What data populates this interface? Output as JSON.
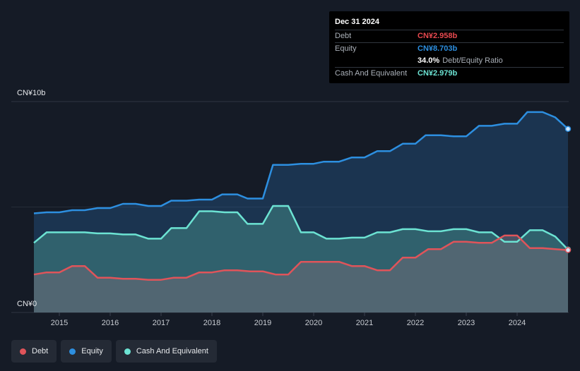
{
  "tooltip": {
    "date": "Dec 31 2024",
    "debt_label": "Debt",
    "debt_value": "CN¥2.958b",
    "equity_label": "Equity",
    "equity_value": "CN¥8.703b",
    "ratio_value": "34.0%",
    "ratio_label": "Debt/Equity Ratio",
    "cash_label": "Cash And Equivalent",
    "cash_value": "CN¥2.979b"
  },
  "legend": [
    {
      "label": "Debt",
      "color": "#e0545a"
    },
    {
      "label": "Equity",
      "color": "#2d8fe0"
    },
    {
      "label": "Cash And Equivalent",
      "color": "#6ce3d3"
    }
  ],
  "chart_data": {
    "type": "area",
    "y_top_label": "CN¥10b",
    "y_bottom_label": "CN¥0",
    "ylim": [
      0,
      10
    ],
    "xlim": [
      2014.5,
      2025.0
    ],
    "x_ticks": [
      "2015",
      "2016",
      "2017",
      "2018",
      "2019",
      "2020",
      "2021",
      "2022",
      "2023",
      "2024"
    ],
    "series": [
      {
        "name": "Equity",
        "color": "#2d8fe0",
        "points": [
          [
            2014.5,
            4.7
          ],
          [
            2014.75,
            4.75
          ],
          [
            2015.0,
            4.75
          ],
          [
            2015.25,
            4.85
          ],
          [
            2015.5,
            4.85
          ],
          [
            2015.75,
            4.95
          ],
          [
            2016.0,
            4.95
          ],
          [
            2016.25,
            5.15
          ],
          [
            2016.5,
            5.15
          ],
          [
            2016.75,
            5.05
          ],
          [
            2017.0,
            5.05
          ],
          [
            2017.2,
            5.3
          ],
          [
            2017.5,
            5.3
          ],
          [
            2017.75,
            5.35
          ],
          [
            2018.0,
            5.35
          ],
          [
            2018.2,
            5.6
          ],
          [
            2018.5,
            5.6
          ],
          [
            2018.7,
            5.4
          ],
          [
            2019.0,
            5.4
          ],
          [
            2019.2,
            7.0
          ],
          [
            2019.5,
            7.0
          ],
          [
            2019.75,
            7.05
          ],
          [
            2020.0,
            7.05
          ],
          [
            2020.2,
            7.15
          ],
          [
            2020.5,
            7.15
          ],
          [
            2020.75,
            7.35
          ],
          [
            2021.0,
            7.35
          ],
          [
            2021.25,
            7.65
          ],
          [
            2021.5,
            7.65
          ],
          [
            2021.75,
            8.0
          ],
          [
            2022.0,
            8.0
          ],
          [
            2022.2,
            8.4
          ],
          [
            2022.5,
            8.4
          ],
          [
            2022.75,
            8.35
          ],
          [
            2023.0,
            8.35
          ],
          [
            2023.25,
            8.85
          ],
          [
            2023.5,
            8.85
          ],
          [
            2023.75,
            8.95
          ],
          [
            2024.0,
            8.95
          ],
          [
            2024.2,
            9.5
          ],
          [
            2024.5,
            9.5
          ],
          [
            2024.75,
            9.25
          ],
          [
            2025.0,
            8.703
          ]
        ]
      },
      {
        "name": "Cash And Equivalent",
        "color": "#6ce3d3",
        "points": [
          [
            2014.5,
            3.3
          ],
          [
            2014.75,
            3.8
          ],
          [
            2015.0,
            3.8
          ],
          [
            2015.25,
            3.8
          ],
          [
            2015.5,
            3.8
          ],
          [
            2015.75,
            3.75
          ],
          [
            2016.0,
            3.75
          ],
          [
            2016.25,
            3.7
          ],
          [
            2016.5,
            3.7
          ],
          [
            2016.75,
            3.5
          ],
          [
            2017.0,
            3.5
          ],
          [
            2017.2,
            4.0
          ],
          [
            2017.5,
            4.0
          ],
          [
            2017.75,
            4.8
          ],
          [
            2018.0,
            4.8
          ],
          [
            2018.25,
            4.75
          ],
          [
            2018.5,
            4.75
          ],
          [
            2018.7,
            4.2
          ],
          [
            2019.0,
            4.2
          ],
          [
            2019.2,
            5.05
          ],
          [
            2019.5,
            5.05
          ],
          [
            2019.75,
            3.8
          ],
          [
            2020.0,
            3.8
          ],
          [
            2020.25,
            3.5
          ],
          [
            2020.5,
            3.5
          ],
          [
            2020.75,
            3.55
          ],
          [
            2021.0,
            3.55
          ],
          [
            2021.25,
            3.8
          ],
          [
            2021.5,
            3.8
          ],
          [
            2021.75,
            3.95
          ],
          [
            2022.0,
            3.95
          ],
          [
            2022.25,
            3.85
          ],
          [
            2022.5,
            3.85
          ],
          [
            2022.75,
            3.95
          ],
          [
            2023.0,
            3.95
          ],
          [
            2023.25,
            3.8
          ],
          [
            2023.5,
            3.8
          ],
          [
            2023.75,
            3.35
          ],
          [
            2024.0,
            3.35
          ],
          [
            2024.25,
            3.9
          ],
          [
            2024.5,
            3.9
          ],
          [
            2024.75,
            3.6
          ],
          [
            2025.0,
            2.979
          ]
        ]
      },
      {
        "name": "Debt",
        "color": "#e0545a",
        "points": [
          [
            2014.5,
            1.8
          ],
          [
            2014.75,
            1.9
          ],
          [
            2015.0,
            1.9
          ],
          [
            2015.25,
            2.2
          ],
          [
            2015.5,
            2.2
          ],
          [
            2015.75,
            1.65
          ],
          [
            2016.0,
            1.65
          ],
          [
            2016.25,
            1.6
          ],
          [
            2016.5,
            1.6
          ],
          [
            2016.75,
            1.55
          ],
          [
            2017.0,
            1.55
          ],
          [
            2017.25,
            1.65
          ],
          [
            2017.5,
            1.65
          ],
          [
            2017.75,
            1.9
          ],
          [
            2018.0,
            1.9
          ],
          [
            2018.25,
            2.0
          ],
          [
            2018.5,
            2.0
          ],
          [
            2018.75,
            1.95
          ],
          [
            2019.0,
            1.95
          ],
          [
            2019.25,
            1.8
          ],
          [
            2019.5,
            1.8
          ],
          [
            2019.75,
            2.4
          ],
          [
            2020.0,
            2.4
          ],
          [
            2020.25,
            2.4
          ],
          [
            2020.5,
            2.4
          ],
          [
            2020.75,
            2.2
          ],
          [
            2021.0,
            2.2
          ],
          [
            2021.25,
            2.0
          ],
          [
            2021.5,
            2.0
          ],
          [
            2021.75,
            2.6
          ],
          [
            2022.0,
            2.6
          ],
          [
            2022.25,
            3.0
          ],
          [
            2022.5,
            3.0
          ],
          [
            2022.75,
            3.35
          ],
          [
            2023.0,
            3.35
          ],
          [
            2023.25,
            3.3
          ],
          [
            2023.5,
            3.3
          ],
          [
            2023.75,
            3.65
          ],
          [
            2024.0,
            3.65
          ],
          [
            2024.25,
            3.05
          ],
          [
            2024.5,
            3.05
          ],
          [
            2024.75,
            3.0
          ],
          [
            2025.0,
            2.958
          ]
        ]
      }
    ]
  }
}
